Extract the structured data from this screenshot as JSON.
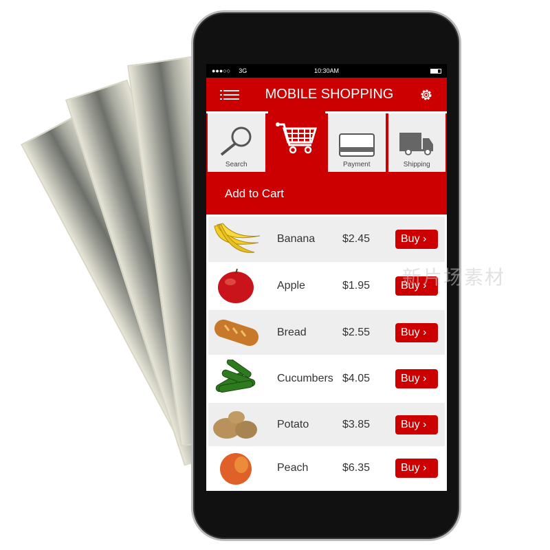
{
  "status_bar": {
    "signal": "●●●○○",
    "network": "3G",
    "time": "10:30AM",
    "battery": "battery-icon"
  },
  "header": {
    "title": "MOBILE SHOPPING",
    "menu_icon": "hamburger-icon",
    "settings_icon": "gear-icon"
  },
  "tabs": [
    {
      "label": "Search",
      "icon": "magnifier-icon"
    },
    {
      "label": "",
      "icon": "cart-icon",
      "active": true
    },
    {
      "label": "Payment",
      "icon": "credit-card-icon"
    },
    {
      "label": "Shipping",
      "icon": "truck-icon"
    }
  ],
  "banner": {
    "title": "Add to Cart"
  },
  "products": [
    {
      "name": "Banana",
      "price": "$2.45",
      "button": "Buy ›"
    },
    {
      "name": "Apple",
      "price": "$1.95",
      "button": "Buy ›"
    },
    {
      "name": "Bread",
      "price": "$2.55",
      "button": "Buy ›"
    },
    {
      "name": "Cucumbers",
      "price": "$4.05",
      "button": "Buy ›"
    },
    {
      "name": "Potato",
      "price": "$3.85",
      "button": "Buy ›"
    },
    {
      "name": "Peach",
      "price": "$6.35",
      "button": "Buy ›"
    }
  ],
  "watermark": "新片场素材",
  "colors": {
    "accent": "#cc0000",
    "tab_bg": "#eeeeee"
  }
}
